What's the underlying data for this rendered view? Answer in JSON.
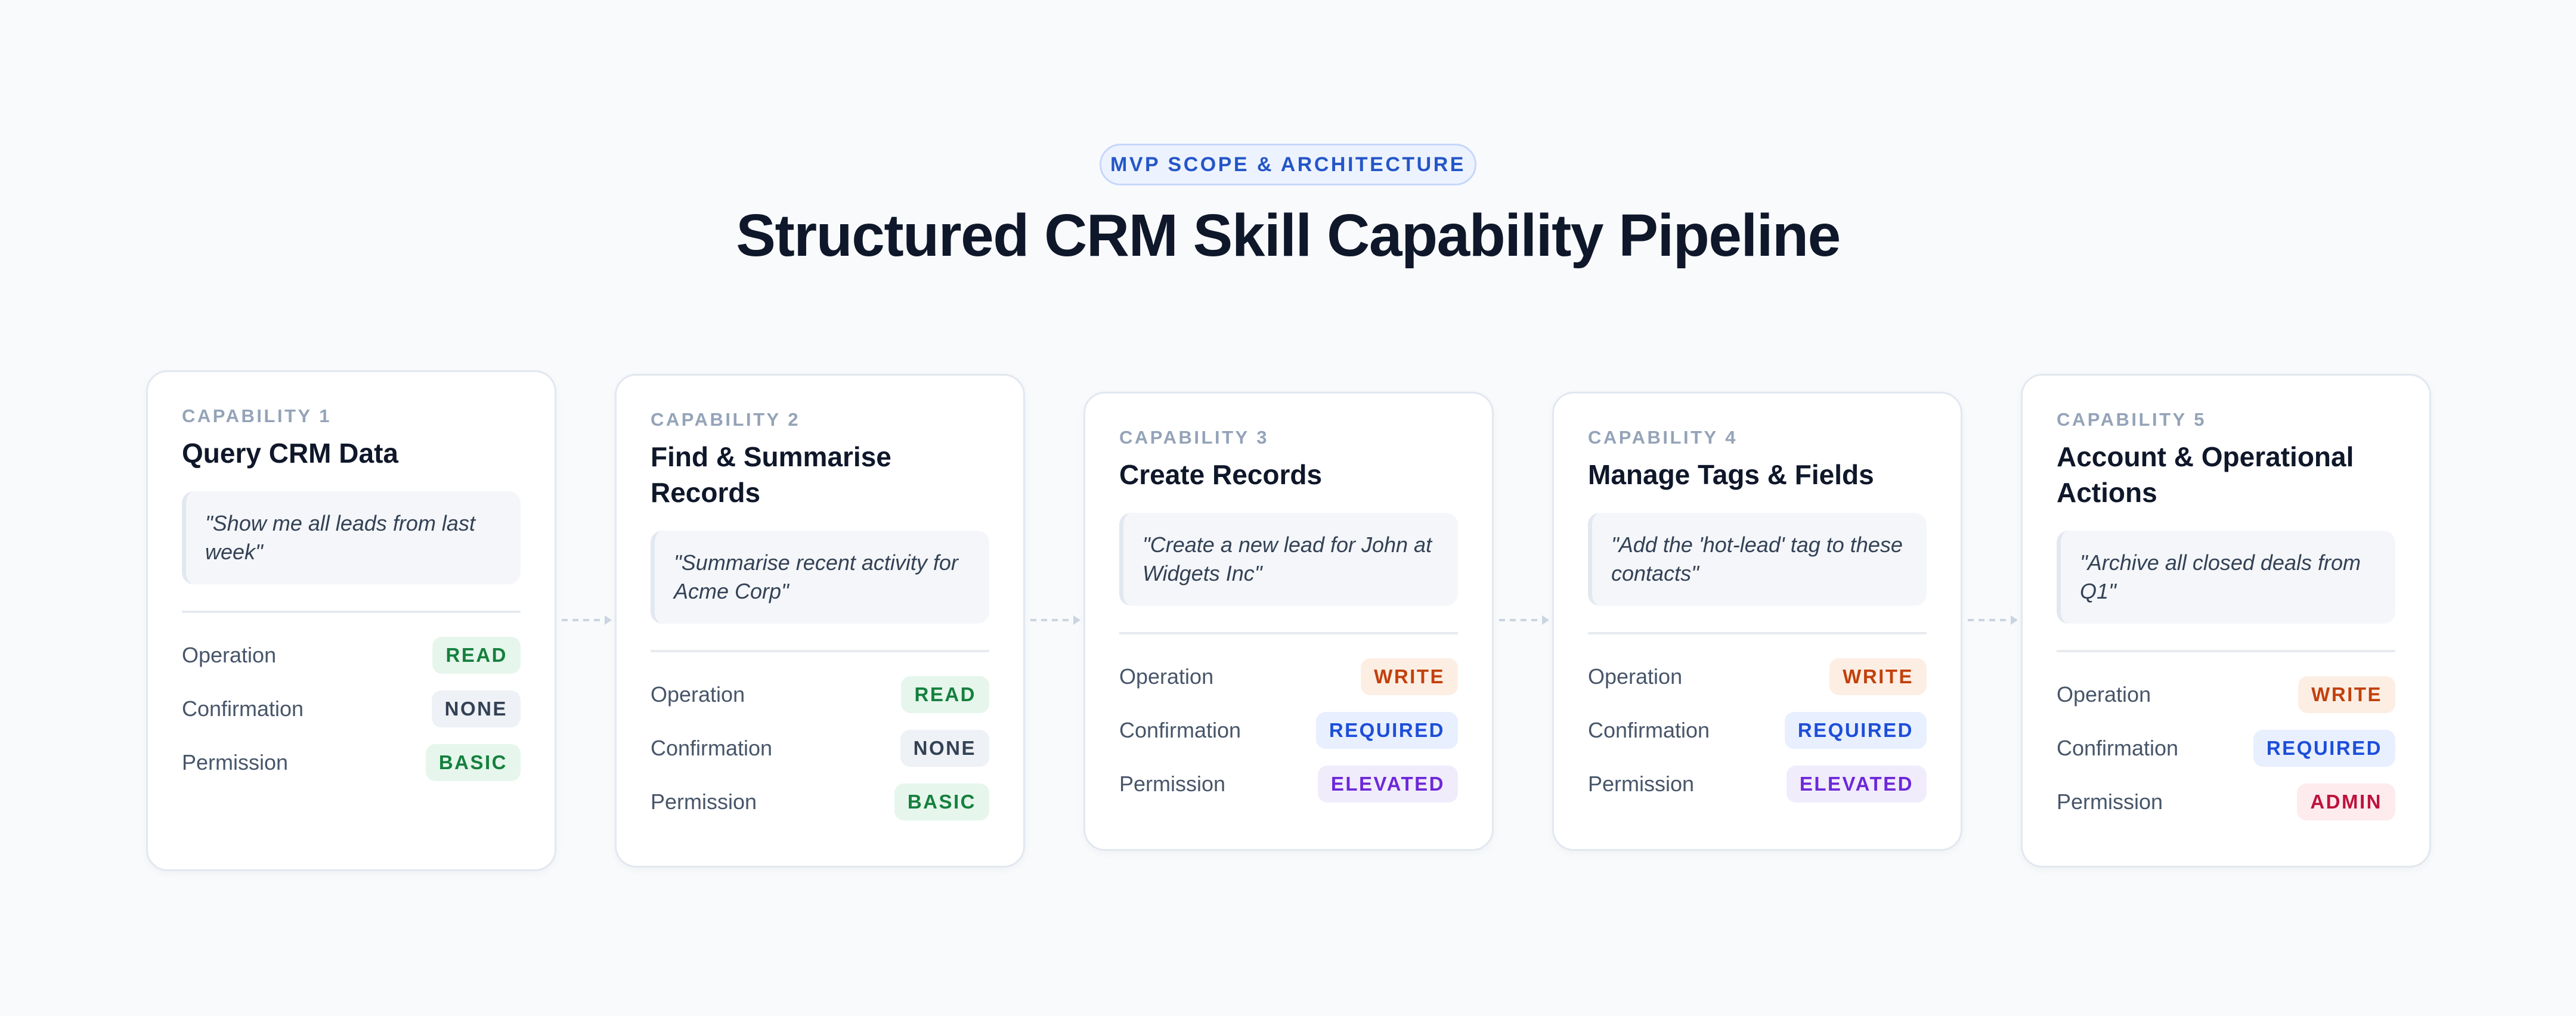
{
  "header": {
    "eyebrow": "MVP SCOPE & ARCHITECTURE",
    "title": "Structured CRM Skill Capability Pipeline"
  },
  "colors": {
    "green": {
      "text": "#15803d",
      "bg": "#e6f6ec"
    },
    "slate": {
      "text": "#334155",
      "bg": "#eef1f5"
    },
    "orange": {
      "text": "#c2410c",
      "bg": "#fdeee4"
    },
    "blue": {
      "text": "#1d4ed8",
      "bg": "#e8efff"
    },
    "purple": {
      "text": "#6d28d9",
      "bg": "#f1ecfc"
    },
    "red": {
      "text": "#be123c",
      "bg": "#fdebee"
    }
  },
  "cards": [
    {
      "label": "CAPABILITY 1",
      "title": "Query CRM Data",
      "quote": "\"Show me all leads from last week\"",
      "rows": [
        {
          "label": "Operation",
          "value": "READ",
          "tone": "green"
        },
        {
          "label": "Confirmation",
          "value": "NONE",
          "tone": "slate"
        },
        {
          "label": "Permission",
          "value": "BASIC",
          "tone": "green"
        }
      ]
    },
    {
      "label": "CAPABILITY 2",
      "title": "Find & Summarise Records",
      "quote": "\"Summarise recent activity for Acme Corp\"",
      "rows": [
        {
          "label": "Operation",
          "value": "READ",
          "tone": "green"
        },
        {
          "label": "Confirmation",
          "value": "NONE",
          "tone": "slate"
        },
        {
          "label": "Permission",
          "value": "BASIC",
          "tone": "green"
        }
      ]
    },
    {
      "label": "CAPABILITY 3",
      "title": "Create Records",
      "quote": "\"Create a new lead for John at Widgets Inc\"",
      "rows": [
        {
          "label": "Operation",
          "value": "WRITE",
          "tone": "orange"
        },
        {
          "label": "Confirmation",
          "value": "REQUIRED",
          "tone": "blue"
        },
        {
          "label": "Permission",
          "value": "ELEVATED",
          "tone": "purple"
        }
      ]
    },
    {
      "label": "CAPABILITY 4",
      "title": "Manage Tags & Fields",
      "quote": "\"Add the 'hot-lead' tag to these contacts\"",
      "rows": [
        {
          "label": "Operation",
          "value": "WRITE",
          "tone": "orange"
        },
        {
          "label": "Confirmation",
          "value": "REQUIRED",
          "tone": "blue"
        },
        {
          "label": "Permission",
          "value": "ELEVATED",
          "tone": "purple"
        }
      ]
    },
    {
      "label": "CAPABILITY 5",
      "title": "Account & Operational Actions",
      "quote": "\"Archive all closed deals from Q1\"",
      "rows": [
        {
          "label": "Operation",
          "value": "WRITE",
          "tone": "orange"
        },
        {
          "label": "Confirmation",
          "value": "REQUIRED",
          "tone": "blue"
        },
        {
          "label": "Permission",
          "value": "ADMIN",
          "tone": "red"
        }
      ]
    }
  ]
}
